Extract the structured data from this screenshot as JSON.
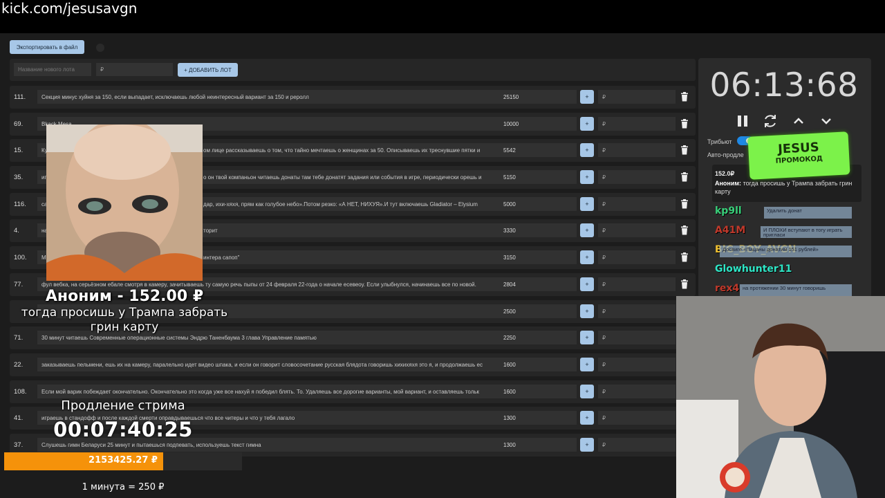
{
  "browser": {
    "url": "kick.com/jesusavgn"
  },
  "toolbar": {
    "export_label": "Экспортировать в файл"
  },
  "add_lot": {
    "name_placeholder": "Название нового лота",
    "price_placeholder": "₽",
    "add_button_label": "+ ДОБАВИТЬ ЛОТ"
  },
  "lots": [
    {
      "num": "111.",
      "title": "Секция минус хуйня за 150, если выпадает, исключаешь любой неинтересный вариант за 150 и реролл",
      "amount": "25150"
    },
    {
      "num": "69.",
      "title": "Bkack Mesa",
      "amount": "10000"
    },
    {
      "num": "15.",
      "title": "Кузба",
      "title_tail": "ом лице рассказываешь о том, что тайно мечтаешь о женщинах за 50. Описываешь их треснувшие пятки и",
      "amount": "5542"
    },
    {
      "num": "35.",
      "title": "играе",
      "title_tail": "о он твой компаньон читаешь донаты там тебе донатят задания или события в игре, периодически орешь и",
      "amount": "5150"
    },
    {
      "num": "116.",
      "title": "сал",
      "title_tail": "дар, ихи-хяхя, прям как голубое небо».Потом резко: «А НЕТ, НИХУЯ».И тут включаешь Gladiator – Elysium",
      "amount": "5000"
    },
    {
      "num": "4.",
      "title": "на като",
      "title_tail": "торит",
      "amount": "3330"
    },
    {
      "num": "100.",
      "title": "Мен",
      "title_tail": "интера сапоп\"",
      "amount": "3150"
    },
    {
      "num": "77.",
      "title": "фул вебка, на серьёзном ебале смотря в камеру, зачитываешь ту самую речь пыпы от 24 февраля 22-года о начале есевеоу. Если улыбнулся, начинаешь все по новой.",
      "amount": "2804"
    },
    {
      "num": "",
      "title": "",
      "amount": "2500"
    },
    {
      "num": "71.",
      "title": "30 минут читаешь Современные операционные системы Эндрю Таненбаума 3 глава Управление памятью",
      "amount": "2250"
    },
    {
      "num": "22.",
      "title": "заказываешь пельмени, ешь их на камеру, паралельно идет видео шпака, и если он говорит словосочетание русская блядота говоришь хихихяхя это я, и продолжаешь ес",
      "amount": "1600"
    },
    {
      "num": "108.",
      "title": "Если мой варик побеждает окончательно. Окончательно это когда уже все нахуй я победил блять. То. Удаляешь все дорогие варианты, мой вариант, и оставляешь тольк",
      "amount": "1600"
    },
    {
      "num": "41.",
      "title": "играешь в стандофф и после каждой смерти оправдываешься что все читеры и что у тебя лагало",
      "amount": "1300"
    },
    {
      "num": "37.",
      "title": "Слушешь гимн Беларуси 25 минут и пытаешься подпевать, используешь текст гимна",
      "amount": "1300"
    }
  ],
  "lot_plus_label": "+",
  "lot_input_placeholder": "₽",
  "side_panel": {
    "timer": "06:13:68",
    "tribute_label": "Трибьют",
    "auto_label": "Авто-продле",
    "last_donation": {
      "amount": "152.0₽",
      "author": "Аноним:",
      "message": "тогда просишь у Трампа забрать грин карту"
    }
  },
  "promo": {
    "top": "JESUS",
    "bottom": "ПРОМОКОД"
  },
  "chat": [
    {
      "user": "kp9ll",
      "color": "#39d07a",
      "text": "Удалить донат"
    },
    {
      "user": "A41M",
      "color": "#c0392b",
      "text": "И ПЛОХИ вступают в тогу играть пригласи"
    },
    {
      "user": "BIG_BOY_AVGN",
      "color": "#f2c230",
      "text": "Досвиге «Пацаны донатим 151 рублей»"
    },
    {
      "user": "Glowhunter11",
      "color": "#2ee6c6",
      "text": ""
    },
    {
      "user": "rex4",
      "color": "#c0392b",
      "text": "на протяжении 30 минут говоришь"
    }
  ],
  "alert": {
    "title": "Аноним - 152.00 ₽",
    "message": "тогда просишь у Трампа забрать грин карту"
  },
  "extension": {
    "label": "Продление стрима",
    "timer": "00:07:40:25",
    "total": "2153425.27 ₽",
    "progress_fraction": 0.67,
    "rate": "1 минута = 250 ₽"
  },
  "colors": {
    "accent": "#a7c7e7",
    "progress": "#f5920a",
    "promo": "#7cf24a",
    "toggle": "#1e88e5"
  }
}
